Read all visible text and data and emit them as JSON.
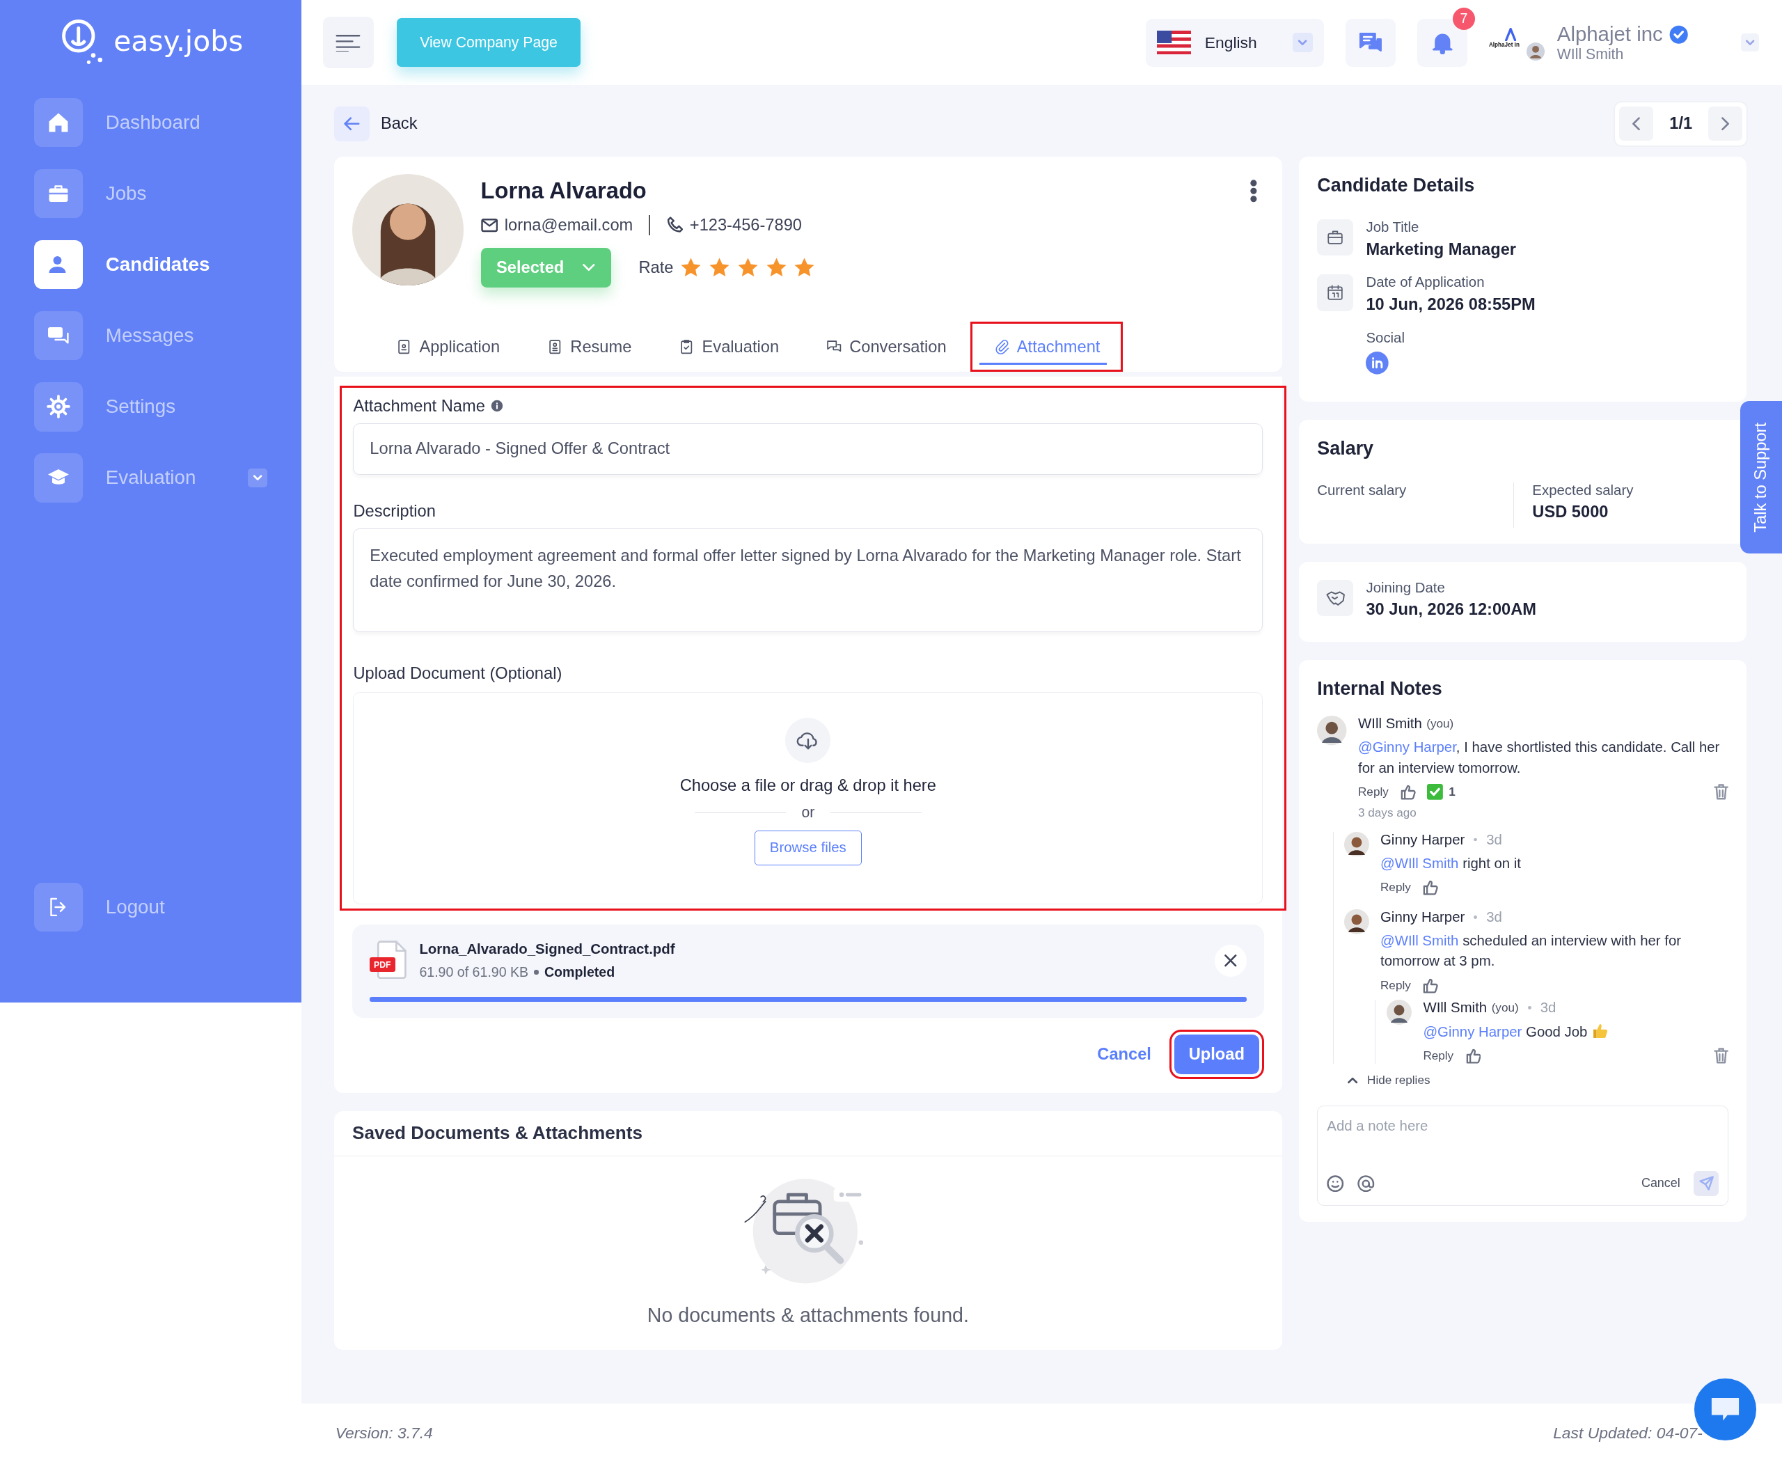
{
  "sidebar": {
    "logo": "easy.jobs",
    "items": [
      {
        "label": "Dashboard",
        "selected": false
      },
      {
        "label": "Jobs",
        "selected": false
      },
      {
        "label": "Candidates",
        "selected": true
      },
      {
        "label": "Messages",
        "selected": false
      },
      {
        "label": "Settings",
        "selected": false
      },
      {
        "label": "Evaluation",
        "selected": false,
        "expanded": false
      }
    ],
    "logout": "Logout"
  },
  "topbar": {
    "company_page_button": "View Company Page",
    "language": "English",
    "notification_count": "7",
    "company": {
      "logo_text": "AlphaJet In",
      "name": "Alphajet inc",
      "verified": true,
      "user": "WIll Smith"
    }
  },
  "back": "Back",
  "pager": "1/1",
  "candidate": {
    "name": "Lorna Alvarado",
    "email": "lorna@email.com",
    "phone": "+123-456-7890",
    "status": "Selected",
    "rate_label": "Rate",
    "stars": 5
  },
  "tabs": [
    {
      "label": "Application",
      "selected": false,
      "highlighted": false
    },
    {
      "label": "Resume",
      "selected": false,
      "highlighted": false
    },
    {
      "label": "Evaluation",
      "selected": false,
      "highlighted": false
    },
    {
      "label": "Conversation",
      "selected": false,
      "highlighted": false
    },
    {
      "label": "Attachment",
      "selected": true,
      "highlighted": true
    }
  ],
  "form": {
    "highlighted": true,
    "name_label": "Attachment Name",
    "name_value": "Lorna Alvarado - Signed Offer & Contract",
    "description_label": "Description",
    "description_value": "Executed employment agreement and formal offer letter signed by Lorna Alvarado for the Marketing Manager role. Start date confirmed for June 30, 2026.",
    "upload_label": "Upload Document (Optional)",
    "drop_text": "Choose a file or drag & drop it here",
    "or": "or",
    "browse": "Browse files"
  },
  "file": {
    "badge": "PDF",
    "name": "Lorna_Alvarado_Signed_Contract.pdf",
    "size": "61.90 of 61.90 KB",
    "status": "Completed",
    "level": 1
  },
  "actions": {
    "cancel": "Cancel",
    "upload": "Upload",
    "upload_highlighted": true
  },
  "saved": {
    "title": "Saved Documents & Attachments",
    "empty": "No documents & attachments found."
  },
  "details": {
    "title": "Candidate Details",
    "fields": [
      {
        "kind": "job",
        "label": "Job Title",
        "value": "Marketing Manager"
      },
      {
        "kind": "date",
        "label": "Date of Application",
        "value": "10 Jun, 2026 08:55PM"
      },
      {
        "kind": "social",
        "label": "Social"
      }
    ]
  },
  "salary": {
    "title": "Salary",
    "current_label": "Current salary",
    "expected_label": "Expected salary",
    "expected_value": "USD 5000"
  },
  "joining": {
    "label": "Joining Date",
    "value": "30 Jun, 2026 12:00AM"
  },
  "notes": {
    "title": "Internal Notes",
    "comments": [
      {
        "author": "WIll Smith",
        "you": "(you)",
        "mention": "@Ginny Harper",
        "text": ", I have shortlisted this candidate. Call her for an interview tomorrow.",
        "reply": "Reply",
        "reaction_count": "1",
        "ago": "3 days ago",
        "deletable": true,
        "children": [
          {
            "author": "Ginny Harper",
            "time": "3d",
            "mention": "@WIll Smith",
            "text": " right on it",
            "reply": "Reply",
            "deletable": false
          },
          {
            "author": "Ginny Harper",
            "time": "3d",
            "mention": "@WIll Smith",
            "text": " scheduled an interview with her for tomorrow at 3 pm.",
            "reply": "Reply",
            "deletable": false,
            "children": [
              {
                "author": "WIll Smith",
                "you": "(you)",
                "time": "3d",
                "mention": "@Ginny Harper",
                "text": " Good Job",
                "thumb": true,
                "reply": "Reply",
                "deletable": true
              }
            ]
          }
        ]
      }
    ],
    "hide_replies": "Hide replies",
    "placeholder": "Add a note here",
    "cancel": "Cancel"
  },
  "support": "Talk to Support",
  "footer": {
    "version": "Version: 3.7.4",
    "updated": "Last Updated: 04-07-"
  }
}
